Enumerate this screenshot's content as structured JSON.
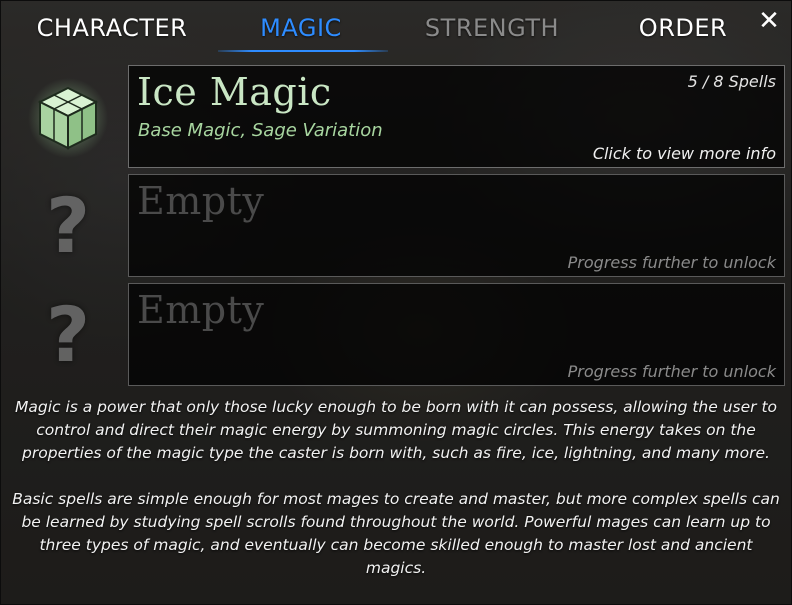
{
  "tabs": [
    {
      "label": "CHARACTER",
      "active": false
    },
    {
      "label": "MAGIC",
      "active": true
    },
    {
      "label": "STRENGTH",
      "active": false
    },
    {
      "label": "ORDER",
      "active": false
    }
  ],
  "close_icon": "close-icon",
  "colors": {
    "active_tab": "#2e8cff",
    "disabled_tab": "#8a8a8a",
    "magic_title": "#c9e6c4",
    "magic_subtitle": "#a8d6a0"
  },
  "slots": [
    {
      "icon": "ice-cube-icon",
      "title": "Ice Magic",
      "subtitle": "Base Magic, Sage Variation",
      "count": "5 / 8 Spells",
      "hint": "Click to view more info"
    },
    {
      "icon": "question-mark-icon",
      "title": "Empty",
      "hint": "Progress further to unlock"
    },
    {
      "icon": "question-mark-icon",
      "title": "Empty",
      "hint": "Progress further to unlock"
    }
  ],
  "description": {
    "p1": "Magic is a power that only those lucky enough to be born with it can possess, allowing the user to control and direct their magic energy by summoning magic circles. This energy takes on the properties of the magic type the caster is born with, such as fire, ice, lightning, and many more.",
    "p2": "Basic spells are simple enough for most mages to create and master, but more complex spells can be learned by studying spell scrolls found throughout the world. Powerful mages can learn up to three types of magic, and eventually can become skilled enough to master lost and ancient magics."
  }
}
